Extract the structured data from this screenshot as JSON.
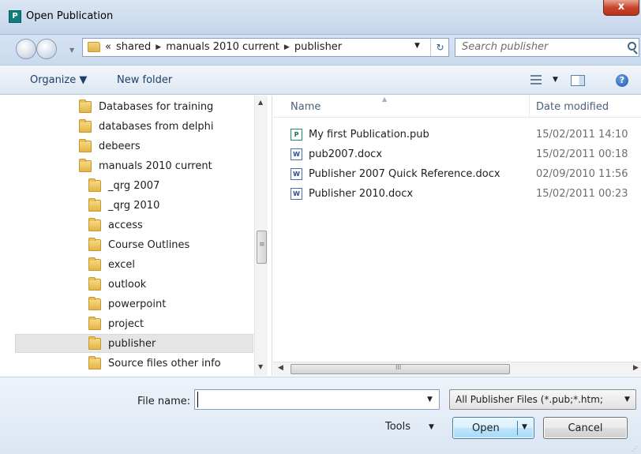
{
  "window": {
    "title": "Open Publication",
    "app_icon_letter": "P",
    "close_symbol": "x"
  },
  "address_bar": {
    "overflow": "«",
    "crumbs": [
      "shared",
      "manuals 2010 current",
      "publisher"
    ],
    "search_placeholder": "Search publisher"
  },
  "toolbar": {
    "organize_label": "Organize ▼",
    "new_folder_label": "New folder"
  },
  "nav_tree": {
    "items": [
      {
        "label": "Databases for training"
      },
      {
        "label": "databases from delphi"
      },
      {
        "label": "debeers"
      },
      {
        "label": "manuals 2010 current"
      },
      {
        "label": "_qrg 2007"
      },
      {
        "label": "_qrg 2010"
      },
      {
        "label": "access"
      },
      {
        "label": "Course Outlines"
      },
      {
        "label": "excel"
      },
      {
        "label": "outlook"
      },
      {
        "label": "powerpoint"
      },
      {
        "label": "project"
      },
      {
        "label": "publisher"
      },
      {
        "label": "Source files other info"
      }
    ],
    "selected": "publisher"
  },
  "file_list": {
    "columns": {
      "name": "Name",
      "date": "Date modified"
    },
    "files": [
      {
        "name": "My first Publication.pub",
        "date": "15/02/2011 14:10",
        "type": "pub"
      },
      {
        "name": "pub2007.docx",
        "date": "15/02/2011 00:18",
        "type": "docx"
      },
      {
        "name": "Publisher 2007 Quick Reference.docx",
        "date": "02/09/2010 11:56",
        "type": "docx"
      },
      {
        "name": "Publisher 2010.docx",
        "date": "15/02/2011 00:23",
        "type": "docx"
      }
    ]
  },
  "footer": {
    "file_name_label": "File name:",
    "file_name_value": "",
    "file_type_value": "All Publisher Files (*.pub;*.htm;",
    "tools_label": "Tools",
    "open_label": "Open",
    "cancel_label": "Cancel"
  },
  "colors": {
    "accent": "#3c7fb1",
    "selection": "#e5e5e5",
    "title_bar": "#c4d5ea",
    "close_button": "#c8462d"
  },
  "icons": {
    "app": "publisher-icon",
    "folder": "folder-icon",
    "search": "search-icon",
    "refresh": "refresh-icon",
    "help": "help-icon"
  }
}
